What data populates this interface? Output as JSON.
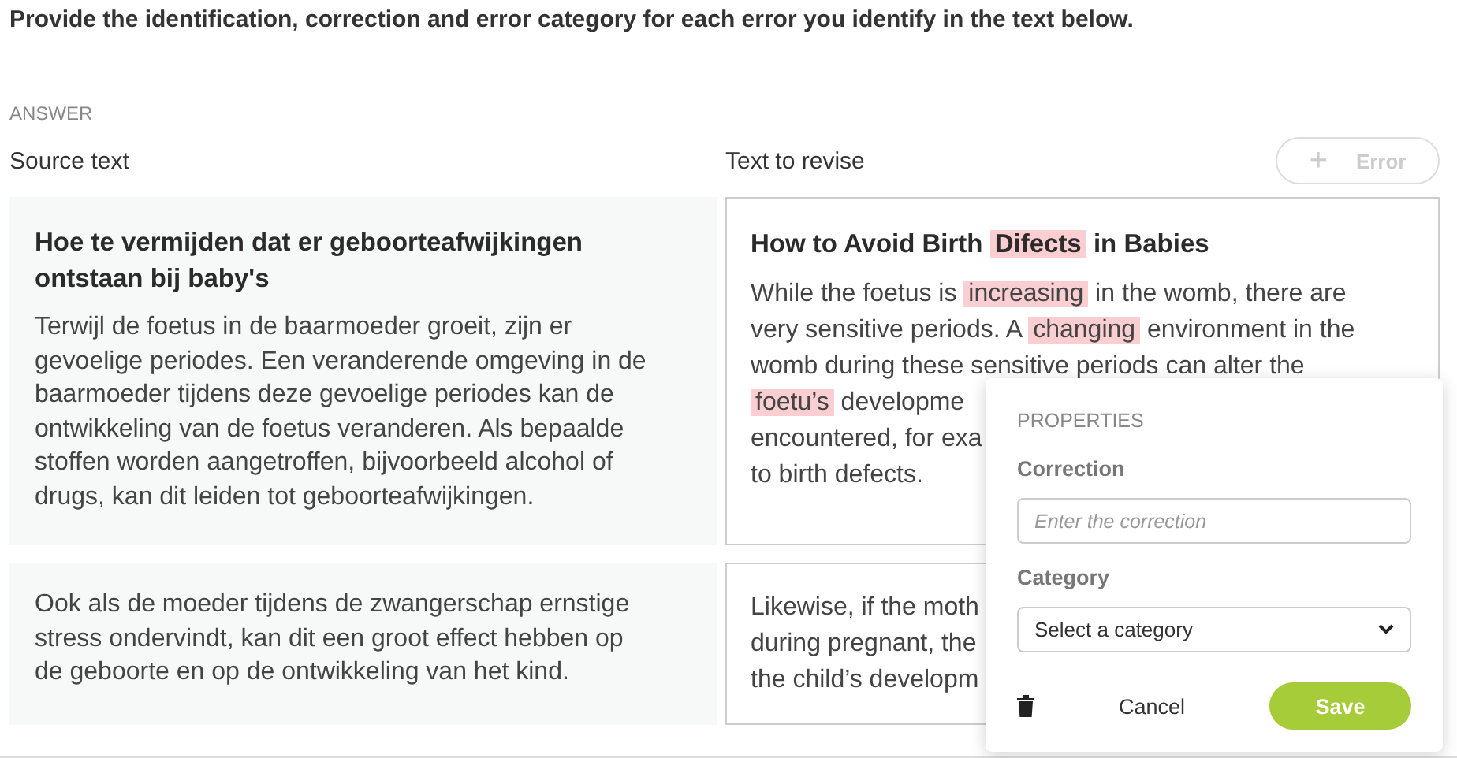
{
  "instruction": "Provide the identification, correction and error category for each error you identify in the text below.",
  "answer_label": "ANSWER",
  "columns": {
    "source": "Source text",
    "revise": "Text to revise"
  },
  "add_error_button": {
    "icon": "+",
    "label": "Error",
    "disabled": true
  },
  "segments": [
    {
      "source": {
        "title": "Hoe te vermijden dat er geboorteafwijkingen ontstaan bij baby's",
        "body": "Terwijl de foetus in de baarmoeder groeit, zijn er gevoelige periodes. Een veranderende omgeving in de baarmoeder tijdens deze gevoelige periodes kan de ontwikkeling van de foetus veranderen. Als bepaalde stoffen worden aangetroffen, bijvoorbeeld alcohol of drugs, kan dit leiden tot geboorteafwijkingen."
      },
      "revise": {
        "title": [
          {
            "text": "How to Avoid Birth ",
            "error": false
          },
          {
            "text": "Difects",
            "error": true
          },
          {
            "text": " in Babies",
            "error": false
          }
        ],
        "lines": [
          [
            {
              "text": "While the foetus is ",
              "error": false
            },
            {
              "text": "increasing",
              "error": true
            },
            {
              "text": " in the womb, there are",
              "error": false
            }
          ],
          [
            {
              "text": "very sensitive periods. A ",
              "error": false
            },
            {
              "text": "changing",
              "error": true
            },
            {
              "text": " environment in the",
              "error": false
            }
          ],
          [
            {
              "text": "womb during these sensitive periods can alter the",
              "error": false
            }
          ],
          [
            {
              "text": "foetu’s",
              "error": true
            },
            {
              "text": " developme",
              "error": false
            }
          ],
          [
            {
              "text": "encountered, for exa",
              "error": false
            }
          ],
          [
            {
              "text": "to birth defects.",
              "error": false
            }
          ]
        ]
      }
    },
    {
      "source": {
        "body": "Ook als de moeder tijdens de zwangerschap ernstige stress ondervindt, kan dit een groot effect hebben op de geboorte en op de ontwikkeling van het kind."
      },
      "revise": {
        "lines": [
          [
            {
              "text": "Likewise, if the moth",
              "error": false
            }
          ],
          [
            {
              "text": "during pregnant, the",
              "error": false
            }
          ],
          [
            {
              "text": "the child’s developm",
              "error": false
            }
          ]
        ]
      }
    }
  ],
  "popup": {
    "heading": "PROPERTIES",
    "correction_label": "Correction",
    "correction_placeholder": "Enter the correction",
    "category_label": "Category",
    "category_value": "Select a category",
    "cancel": "Cancel",
    "save": "Save"
  }
}
